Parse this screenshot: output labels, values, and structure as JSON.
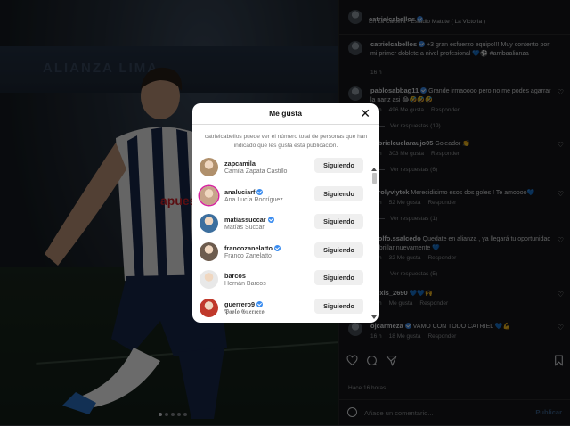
{
  "post": {
    "author": "catrielcabellos",
    "location": "En La Caldera - Estadio Matute ( La Victoria )",
    "caption_user": "catrielcabellos",
    "caption_text": "+3 gran esfuerzo equipo!!! Muy contento por mi primer doblete a nivel profesional 💙⚽ #arribaalianza",
    "caption_time": "16 h",
    "time_ago": "Hace 16 horas",
    "add_comment_placeholder": "Añade un comentario...",
    "publish_label": "Publicar"
  },
  "photo": {
    "stadium_text": "ALIANZA LIMA",
    "jersey_text": "apuesta total"
  },
  "comments": [
    {
      "user": "pablosabbag11",
      "verified": true,
      "text": "Grande irmaoooo pero no me podes agarrar la nariz asi 😂🤣🤣🤣",
      "time": "16 h",
      "likes": "496 Me gusta",
      "reply": "Responder",
      "replies": "Ver respuestas (19)"
    },
    {
      "user": "gabrielcuelaraujo05",
      "verified": false,
      "text": "Goleador 👏",
      "time": "16 h",
      "likes": "303 Me gusta",
      "reply": "Responder",
      "replies": "Ver respuestas (6)"
    },
    {
      "user": "carolyvlytek",
      "verified": false,
      "text": "Merecidisimo esos dos goles ! Te amoooo💙",
      "time": "16 h",
      "likes": "52 Me gusta",
      "reply": "Responder",
      "replies": "Ver respuestas (1)"
    },
    {
      "user": "adolfo.ssalcedo",
      "verified": false,
      "text": "Quedate en alianza , ya llegará tu oportunidad de brillar nuevamente 💙",
      "time": "16 h",
      "likes": "32 Me gusta",
      "reply": "Responder",
      "replies": "Ver respuestas (5)"
    },
    {
      "user": "alexis_2690",
      "verified": false,
      "text": "💙💙🙌",
      "time": "16 h",
      "likes": "Me gusta",
      "reply": "Responder",
      "replies": ""
    },
    {
      "user": "ojcarmeza",
      "verified": true,
      "text": "VAMO CON TODO CATRIEL 💙💪",
      "time": "16 h",
      "likes": "18 Me gusta",
      "reply": "Responder",
      "replies": ""
    }
  ],
  "actions": {
    "like_icon": "heart-icon",
    "comment_icon": "comment-icon",
    "share_icon": "send-icon",
    "save_icon": "bookmark-icon"
  },
  "modal": {
    "title": "Me gusta",
    "info": "catrielcabellos puede ver el número total de personas que han indicado que les gusta esta publicación.",
    "likers": [
      {
        "username": "zapcamila",
        "name": "Camila Zapata Castillo",
        "verified": false,
        "button": "Siguiendo",
        "avatar_color": "#b0906c"
      },
      {
        "username": "analuciarf",
        "name": "Ana Lucía Rodríguez",
        "verified": true,
        "button": "Siguiendo",
        "avatar_color": "#c7a48a"
      },
      {
        "username": "matiassuccar",
        "name": "Matías Succar",
        "verified": true,
        "button": "Siguiendo",
        "avatar_color": "#3d6f9e"
      },
      {
        "username": "francozanelatto",
        "name": "Franco Zanelatto",
        "verified": true,
        "button": "Siguiendo",
        "avatar_color": "#6d5c4e"
      },
      {
        "username": "barcos",
        "name": "Hernán Barcos",
        "verified": false,
        "button": "Siguiendo",
        "avatar_color": "#e8e8e8"
      },
      {
        "username": "guerrero9",
        "name": "𝕻𝖆𝖔𝖑𝖔 𝕲𝖚𝖊𝖗𝖗𝖊𝖗𝖔",
        "verified": true,
        "button": "Siguiendo",
        "avatar_color": "#c0392b"
      }
    ]
  },
  "colors": {
    "verified": "#3b8df0",
    "panel_bg": "#18191b",
    "modal_bg": "#ffffff",
    "follow_btn": "#efefef"
  }
}
